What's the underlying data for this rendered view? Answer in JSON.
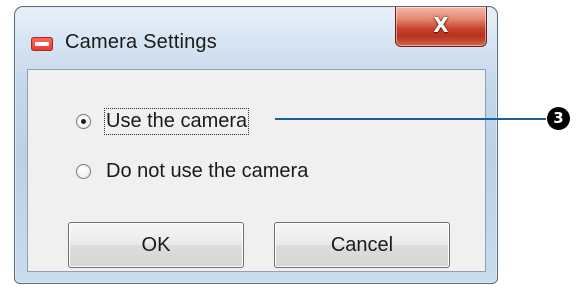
{
  "window": {
    "title": "Camera Settings",
    "close_glyph": "X"
  },
  "options": [
    {
      "label": "Use the camera",
      "checked": true
    },
    {
      "label": "Do not use the camera",
      "checked": false
    }
  ],
  "buttons": {
    "ok_label": "OK",
    "cancel_label": "Cancel"
  },
  "callout": {
    "number": "3"
  },
  "colors": {
    "close_button": "#c8452c",
    "callout_line": "#1b5f99",
    "callout_badge": "#000000",
    "app_icon": "#e8382c"
  },
  "icons": {
    "app": "app-icon",
    "close": "close-icon"
  }
}
